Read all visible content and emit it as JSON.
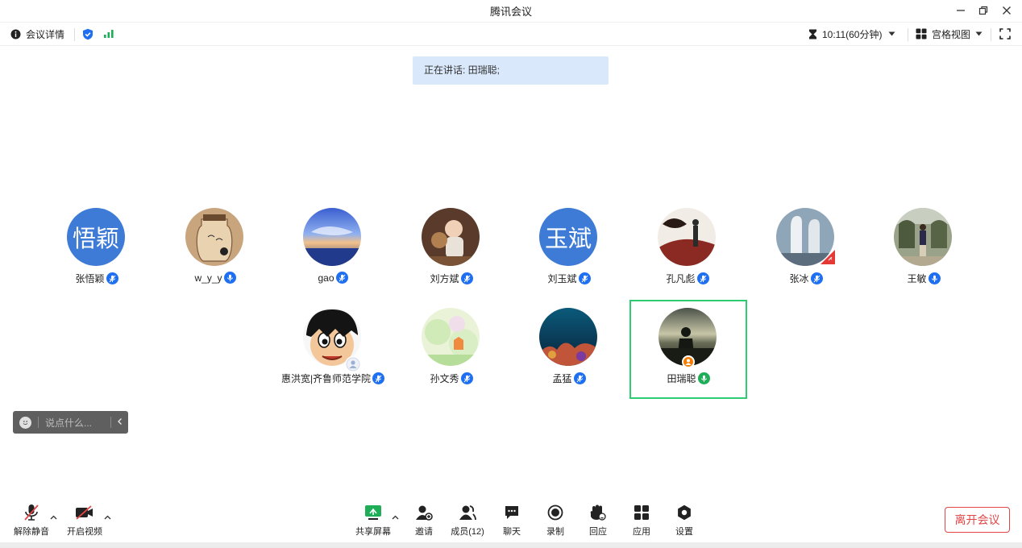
{
  "window": {
    "title": "腾讯会议"
  },
  "topbar": {
    "meeting_details": "会议详情",
    "timer": "10:11(60分钟)",
    "view_mode": "宫格视图"
  },
  "speaking": {
    "text": "正在讲话: 田瑞聪;"
  },
  "participants": [
    {
      "name": "张悟颖",
      "avatar_text": "悟颖"
    },
    {
      "name": "w_y_y"
    },
    {
      "name": "gao"
    },
    {
      "name": "刘方斌"
    },
    {
      "name": "刘玉斌",
      "avatar_text": "玉斌"
    },
    {
      "name": "孔凡彪"
    },
    {
      "name": "张冰"
    },
    {
      "name": "王敏"
    },
    {
      "name": "惠洪宽|齐鲁师范学院"
    },
    {
      "name": "孙文秀"
    },
    {
      "name": "孟猛"
    },
    {
      "name": "田瑞聪"
    }
  ],
  "chat": {
    "placeholder": "说点什么..."
  },
  "bottombar": {
    "unmute": "解除静音",
    "start_video": "开启视频",
    "share_screen": "共享屏幕",
    "invite": "邀请",
    "members": "成员(12)",
    "chat": "聊天",
    "record": "录制",
    "reactions": "回应",
    "apps": "应用",
    "settings": "设置",
    "leave": "离开会议"
  },
  "colors": {
    "accent": "#1e6ff1",
    "speaking_border": "#2ecc71",
    "leave": "#e24646",
    "avatar_bg": "#3d7bd6"
  }
}
